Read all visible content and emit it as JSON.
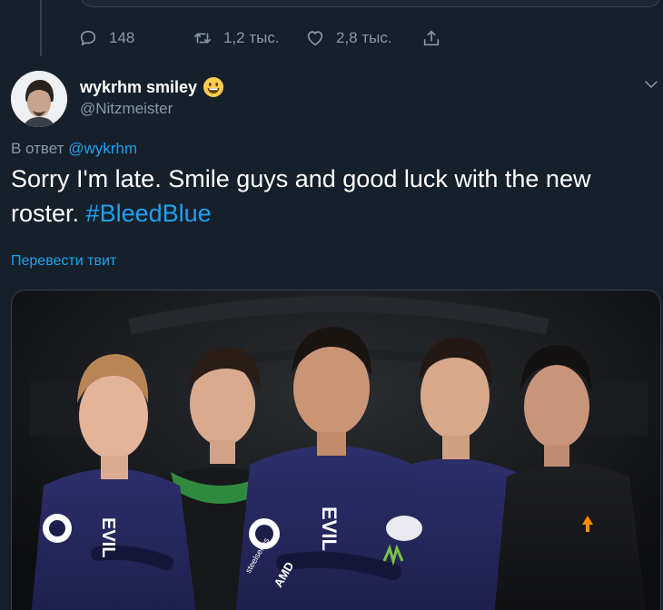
{
  "colors": {
    "background": "#15202b",
    "text_primary": "#ffffff",
    "text_secondary": "#8899a6",
    "link": "#1da1f2",
    "border": "#38444d"
  },
  "previous_tweet": {
    "actions": {
      "reply": {
        "icon": "reply-icon",
        "count": "148"
      },
      "retweet": {
        "icon": "retweet-icon",
        "count": "1,2 тыс."
      },
      "like": {
        "icon": "heart-icon",
        "count": "2,8 тыс."
      },
      "share": {
        "icon": "share-icon"
      }
    }
  },
  "tweet": {
    "author": {
      "display_name": "wykrhm smiley",
      "name_emoji": "smiley-emoji-icon",
      "handle": "@Nitzmeister"
    },
    "menu_icon": "chevron-down-icon",
    "reply_prefix": "В ответ",
    "reply_to": "@wykrhm",
    "text": "Sorry I'm late. Smile guys and good luck with the new roster.",
    "hashtag": "#BleedBlue",
    "translate_label": "Перевести твит",
    "media": {
      "jersey_texts": [
        "EVIL",
        "EVIL",
        "steelseries",
        "AMD"
      ]
    }
  }
}
